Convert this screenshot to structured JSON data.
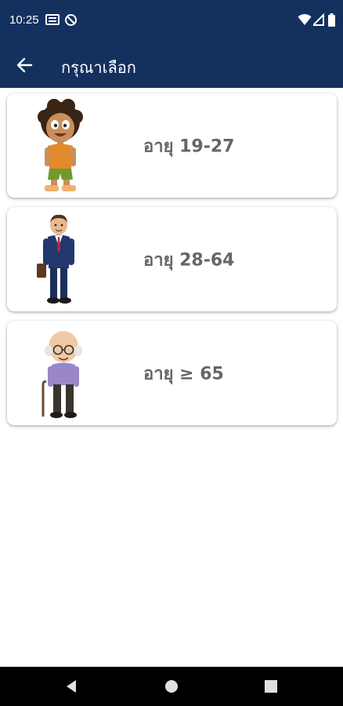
{
  "status_bar": {
    "time": "10:25",
    "icons": [
      "message-icon",
      "nosync-icon",
      "wifi-icon",
      "signal-icon",
      "battery-icon"
    ]
  },
  "app_bar": {
    "title": "กรุณาเลือก",
    "back_icon": "arrow-left-icon"
  },
  "age_options": [
    {
      "label": "อายุ 19-27",
      "figure": "young-person-figure"
    },
    {
      "label": "อายุ 28-64",
      "figure": "businessman-figure"
    },
    {
      "label": "อายุ ≥ 65",
      "figure": "elderly-person-figure"
    }
  ],
  "nav_bar": {
    "icons": [
      "back-triangle-icon",
      "home-circle-icon",
      "recents-square-icon"
    ]
  },
  "colors": {
    "primary": "#13305f",
    "card_text": "#666666",
    "navbar": "#000000"
  }
}
